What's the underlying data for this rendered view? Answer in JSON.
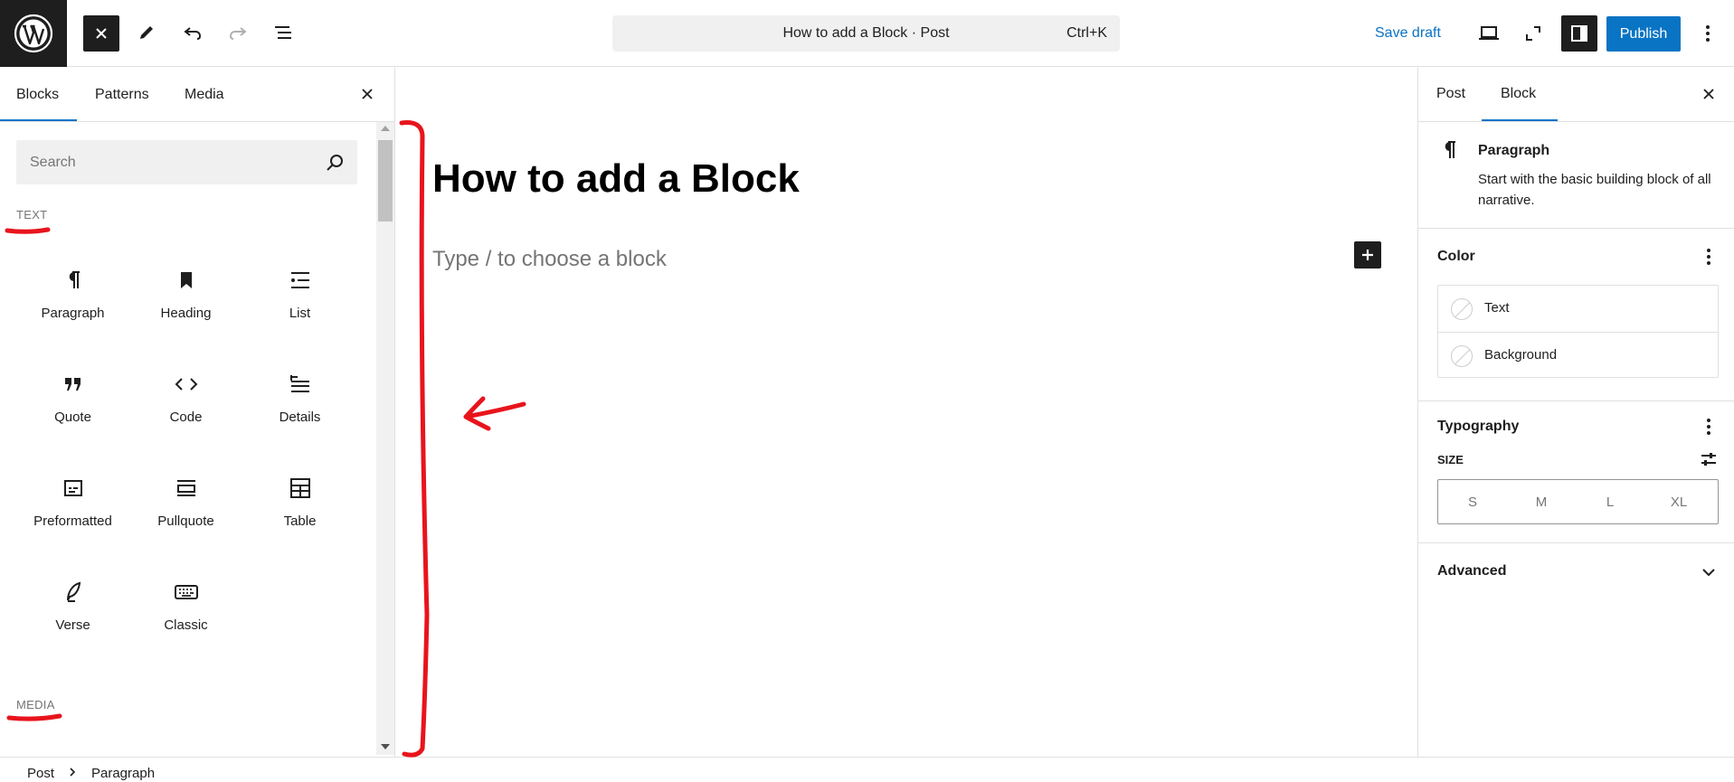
{
  "topbar": {
    "logo_icon": "wordpress-logo-icon",
    "command_title": "How to add a Block · Post",
    "command_shortcut": "Ctrl+K",
    "save_draft": "Save draft",
    "publish": "Publish"
  },
  "inserter": {
    "tabs": [
      {
        "label": "Blocks",
        "active": true
      },
      {
        "label": "Patterns",
        "active": false
      },
      {
        "label": "Media",
        "active": false
      }
    ],
    "search_placeholder": "Search",
    "categories": {
      "text": "TEXT",
      "media": "MEDIA"
    },
    "blocks": [
      {
        "label": "Paragraph",
        "icon": "paragraph-icon"
      },
      {
        "label": "Heading",
        "icon": "heading-icon"
      },
      {
        "label": "List",
        "icon": "list-icon"
      },
      {
        "label": "Quote",
        "icon": "quote-icon"
      },
      {
        "label": "Code",
        "icon": "code-icon"
      },
      {
        "label": "Details",
        "icon": "details-icon"
      },
      {
        "label": "Preformatted",
        "icon": "preformatted-icon"
      },
      {
        "label": "Pullquote",
        "icon": "pullquote-icon"
      },
      {
        "label": "Table",
        "icon": "table-icon"
      },
      {
        "label": "Verse",
        "icon": "verse-icon"
      },
      {
        "label": "Classic",
        "icon": "classic-icon"
      }
    ]
  },
  "editor": {
    "post_title": "How to add a Block",
    "paragraph_placeholder": "Type / to choose a block"
  },
  "sidebar": {
    "tabs": [
      {
        "label": "Post",
        "active": false
      },
      {
        "label": "Block",
        "active": true
      }
    ],
    "block_card": {
      "title": "Paragraph",
      "description": "Start with the basic building block of all narrative."
    },
    "color": {
      "title": "Color",
      "items": [
        "Text",
        "Background"
      ]
    },
    "typography": {
      "title": "Typography",
      "size_label": "SIZE",
      "sizes": [
        "S",
        "M",
        "L",
        "XL"
      ]
    },
    "advanced": {
      "title": "Advanced"
    }
  },
  "footer": {
    "breadcrumbs": [
      "Post",
      "Paragraph"
    ]
  },
  "colors": {
    "accent": "#0a72c6",
    "dark": "#1e1e1e",
    "annotation_red": "#e8141c"
  }
}
